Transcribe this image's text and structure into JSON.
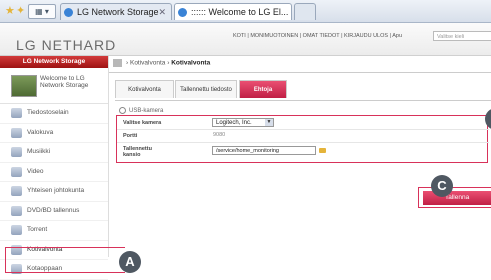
{
  "browser": {
    "tabs": [
      {
        "label": "LG Network Storage"
      },
      {
        "label": ":::::: Welcome to LG El..."
      }
    ]
  },
  "header": {
    "logo": "LG NETHARD",
    "links": "KOTI | MONIMUOTOINEN | OMAT TIEDOT | KIRJAUDU ULOS | Apu",
    "search_placeholder": "Valitse kieli"
  },
  "sidebar": {
    "title": "LG Network Storage",
    "welcome": "Welcome to LG Network Storage",
    "items": [
      {
        "label": "Tiedostoselain",
        "icon": "folder-icon"
      },
      {
        "label": "Valokuva",
        "icon": "photo-icon"
      },
      {
        "label": "Musiikki",
        "icon": "music-icon"
      },
      {
        "label": "Video",
        "icon": "video-icon"
      },
      {
        "label": "Yhteisen johtokunta",
        "icon": "board-icon"
      },
      {
        "label": "DVD/BD tallennus",
        "icon": "disc-icon"
      },
      {
        "label": "Torrent",
        "icon": "torrent-icon"
      },
      {
        "label": "Kotivalvonta",
        "icon": "camera-icon"
      },
      {
        "label": "Kotaoppaan",
        "icon": "guide-icon"
      }
    ]
  },
  "breadcrumb": {
    "level1": "Kotivalvonta",
    "level2": "Kotivalvonta"
  },
  "content_tabs": [
    {
      "label": "Kotivalvonta"
    },
    {
      "label": "Tallennettu tiedosto"
    },
    {
      "label": "Ehtoja"
    }
  ],
  "usb_label": "USB-kamera",
  "form": {
    "camera_label": "Valitse kamera",
    "camera_value": "Logitech, Inc.",
    "port_label": "Portti",
    "port_value": "9080",
    "path_label": "Tallennettu kansio",
    "path_value": "/service/home_monitoring"
  },
  "save_button": "Tallenna",
  "callouts": {
    "a": "A",
    "b": "B",
    "c": "C"
  },
  "colors": {
    "accent": "#d8325a",
    "brand_red": "#c01f45",
    "callout": "#4f5862"
  }
}
